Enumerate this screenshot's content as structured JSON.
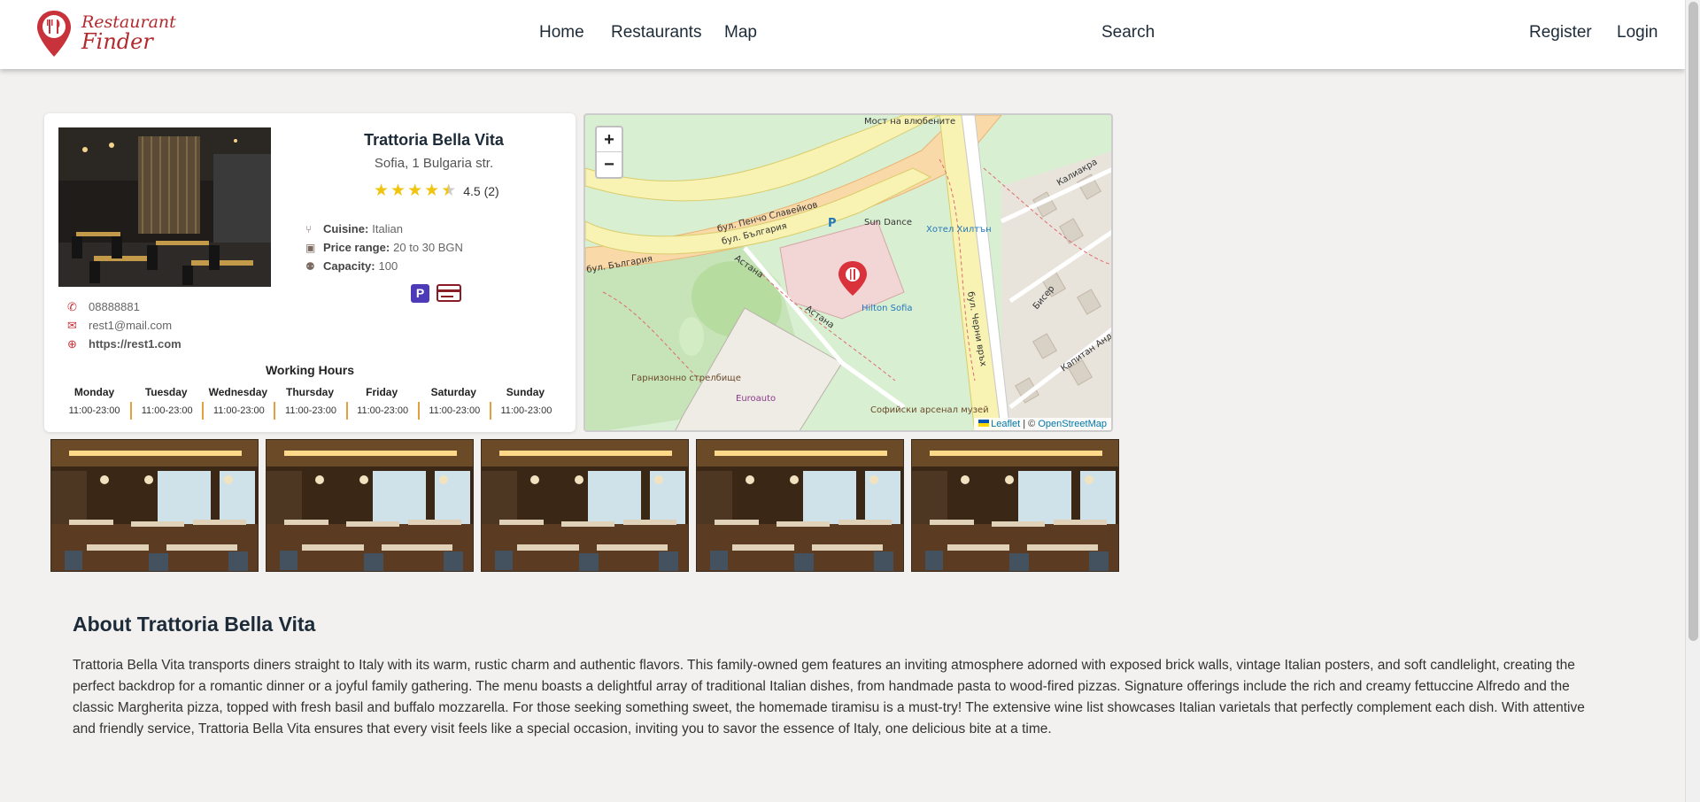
{
  "brand": {
    "line1": "Restaurant",
    "line2": "Finder"
  },
  "nav": {
    "home": "Home",
    "restaurants": "Restaurants",
    "map": "Map",
    "search": "Search",
    "register": "Register",
    "login": "Login"
  },
  "restaurant": {
    "name": "Trattoria Bella Vita",
    "address": "Sofia, 1 Bulgaria str.",
    "rating": "4.5 (2)",
    "rating_value": 4.5,
    "cuisine_label": "Cuisine:",
    "cuisine": "Italian",
    "price_label": "Price range:",
    "price": "20 to 30 BGN",
    "capacity_label": "Capacity:",
    "capacity": "100",
    "amenities": [
      "parking-icon",
      "credit-card-icon"
    ],
    "phone": "08888881",
    "email": "rest1@mail.com",
    "website": "https://rest1.com"
  },
  "working_hours": {
    "title": "Working Hours",
    "days": [
      {
        "day": "Monday",
        "hours": "11:00-23:00"
      },
      {
        "day": "Tuesday",
        "hours": "11:00-23:00"
      },
      {
        "day": "Wednesday",
        "hours": "11:00-23:00"
      },
      {
        "day": "Thursday",
        "hours": "11:00-23:00"
      },
      {
        "day": "Friday",
        "hours": "11:00-23:00"
      },
      {
        "day": "Saturday",
        "hours": "11:00-23:00"
      },
      {
        "day": "Sunday",
        "hours": "11:00-23:00"
      }
    ]
  },
  "map": {
    "zoom_in": "+",
    "zoom_out": "−",
    "leaflet": "Leaflet",
    "separator": "| ©",
    "osm": "OpenStreetMap",
    "labels": {
      "bridge": "Мост на влюбените",
      "street1": "бул. Пенчо Славейков",
      "street2": "бул. България",
      "street3": "бул. България",
      "astana1": "Астана",
      "astana2": "Астана",
      "sundance": "Sun Dance",
      "hotel": "Хотел Хилтън",
      "hilton": "Hilton Sofia",
      "garrison": "Гарнизонно стрелбище",
      "euroauto": "Euroauto",
      "arsenal": "Софийски арсенал музей",
      "cherni": "бул. Черни връх",
      "kaliakra": "Калиакра",
      "biser": "Бисер",
      "kapitan": "Капитан Андреев",
      "parking": "P"
    }
  },
  "gallery": {
    "count": 5
  },
  "about": {
    "title": "About Trattoria Bella Vita",
    "text": "Trattoria Bella Vita transports diners straight to Italy with its warm, rustic charm and authentic flavors. This family-owned gem features an inviting atmosphere adorned with exposed brick walls, vintage Italian posters, and soft candlelight, creating the perfect backdrop for a romantic dinner or a joyful family gathering. The menu boasts a delightful array of traditional Italian dishes, from handmade pasta to wood-fired pizzas. Signature offerings include the rich and creamy fettuccine Alfredo and the classic Margherita pizza, topped with fresh basil and buffalo mozzarella. For those seeking something sweet, the homemade tiramisu is a must-try! The extensive wine list showcases Italian varietals that perfectly complement each dish. With attentive and friendly service, Trattoria Bella Vita ensures that every visit feels like a special occasion, inviting you to savor the essence of Italy, one delicious bite at a time."
  }
}
